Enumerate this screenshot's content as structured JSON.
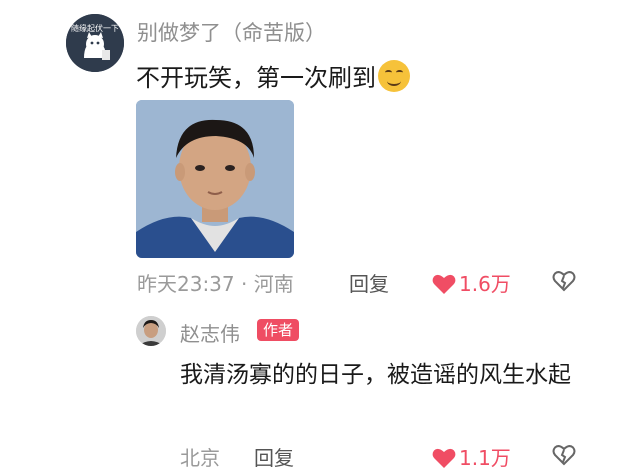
{
  "comment": {
    "avatar_text": "随缘起伏一下",
    "username": "别做梦了（命苦版）",
    "text": "不开玩笑，第一次刷到",
    "time": "昨天23:37",
    "location": "河南",
    "reply_label": "回复",
    "likes": "1.6万"
  },
  "reply": {
    "username": "赵志伟",
    "badge": "作者",
    "text": "我清汤寡的的日子，被造谣的风生水起",
    "location": "北京",
    "reply_label": "回复",
    "likes": "1.1万"
  },
  "colors": {
    "like": "#f04d64",
    "author_badge": "#ef4d63",
    "muted_text": "#9a9a9a"
  },
  "icons": {
    "like": "heart-icon",
    "dislike": "broken-heart-icon",
    "emoji": "smiling-face-emoji"
  }
}
